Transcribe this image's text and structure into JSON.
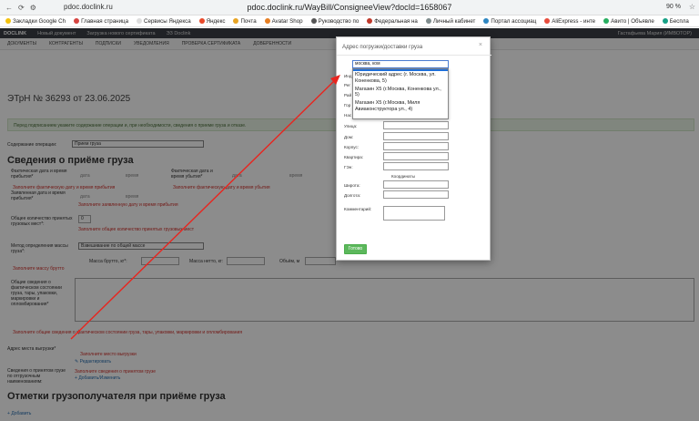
{
  "browser": {
    "domain": "pdoc.doclink.ru",
    "url": "pdoc.doclink.ru/WayBill/ConsigneeView?docId=1658067",
    "zoom": "90 %",
    "bookmarks": [
      {
        "label": "Закладки Google Ch",
        "color": "#f4c20d"
      },
      {
        "label": "Главная страница",
        "color": "#d64541"
      },
      {
        "label": "Сервисы Яндекса",
        "color": "#dddddd"
      },
      {
        "label": "Яндекс",
        "color": "#e8492a"
      },
      {
        "label": "Почта",
        "color": "#e8a423"
      },
      {
        "label": "Avatar Shop",
        "color": "#e67e22"
      },
      {
        "label": "Руководство по",
        "color": "#555555"
      },
      {
        "label": "Федеральная на",
        "color": "#c0392b"
      },
      {
        "label": "Личный кабинет",
        "color": "#7f8c8d"
      },
      {
        "label": "Портал ассоциац",
        "color": "#2e86c1"
      },
      {
        "label": "AliExpress - инте",
        "color": "#e74c3c"
      },
      {
        "label": "Авито | Объявле",
        "color": "#27ae60"
      },
      {
        "label": "Беспла",
        "color": "#16a085"
      }
    ]
  },
  "app": {
    "brand": "DOCLINK",
    "top_links": [
      "Новый документ",
      "Загрузка нового сертификата",
      "ЭЗ Doclink"
    ],
    "user": "Гастафьева Мария (ИМВОТОР)",
    "menu": [
      "Документы",
      "Контрагенты",
      "Подписки",
      "Уведомления",
      "Проверка сертификата",
      "Доверенности"
    ]
  },
  "doc": {
    "title": "ЭТрН №  36293  от  23.06.2025",
    "info": "Перед подписанием укажите содержание операции и, при необходимости, сведения о приеме груза и отказе.",
    "operation_label": "Содержание операции:",
    "operation_value": "Прием груза",
    "section_receipt": "Сведения о приёме груза",
    "actual_arrival_label": "Фактическая дата и время прибытия*",
    "date_hint": "дата",
    "time_hint": "время",
    "actual_departure_label": "Фактическая дата и время убытия*",
    "err_actual_arrival": "Заполните фактическую дату и время прибытия",
    "err_actual_departure": "Заполните фактическую дату и время убытия",
    "declared_arrival_label": "Заявленная дата и время прибытия*",
    "err_declared_arrival": "Заполните заявленную дату и время прибытия",
    "total_places_label": "Общее количество принятых грузовых мест*:",
    "total_places_value": "0",
    "err_total_places": "Заполните общее количество принятых грузовых мест",
    "weight_method_label": "Метод определения массы груза*:",
    "weight_method_value": "Взвешивание по общей массе",
    "gross_label": "Масса брутто, кг*:",
    "net_label": "Масса нетто, кг:",
    "volume_label": "Объём, м",
    "err_gross": "Заполните массу брутто",
    "condition_label": "Общие сведения о фактическом состоянии груза, тары, упаковки, маркировки и опломбирования*",
    "err_condition": "Заполните общие сведения о фактическом состоянии груза, тары, упаковки, маркировки и опломбирования",
    "unload_addr_label": "Адрес места выгрузки*",
    "err_unload_addr": "Заполните место выгрузки",
    "edit_link": "Редактировать",
    "accepted_label": "Сведения о принятом грузе по отгрузочным наименованиям:",
    "err_accepted": "Заполните сведения о принятом грузе",
    "add_edit_link": "Добавить/Изменить",
    "section_marks": "Отметки грузополучателя при приёме груза",
    "add_link": "Добавить"
  },
  "modal": {
    "title": "Адрес погрузки/доставки груза",
    "close": "×",
    "search_value": "москва, ком",
    "options": [
      "Юридический адрес (г. Москва, ул. Коненкова, 5)",
      "Магазин Х5 (г.Москва, Коненкова ул., 5)",
      "Магазин Х5 (г.Москва, Миля Авиаконструктора ул., 4)"
    ],
    "hidden_labels": [
      "Инд",
      "Рег",
      "Рай",
      "Гор",
      "Нас"
    ],
    "fields": [
      "Улица:",
      "Дом:",
      "Корпус:",
      "Квартира:",
      "ГЭн:"
    ],
    "coords_title": "Координаты",
    "lat_label": "Широта:",
    "lon_label": "Долгота:",
    "comment_label": "Комментарий:",
    "submit": "Готово"
  },
  "colors": {
    "error": "#d0302b",
    "link": "#2a6fb0",
    "success": "#5cb85c",
    "arrow": "#e8251f"
  }
}
